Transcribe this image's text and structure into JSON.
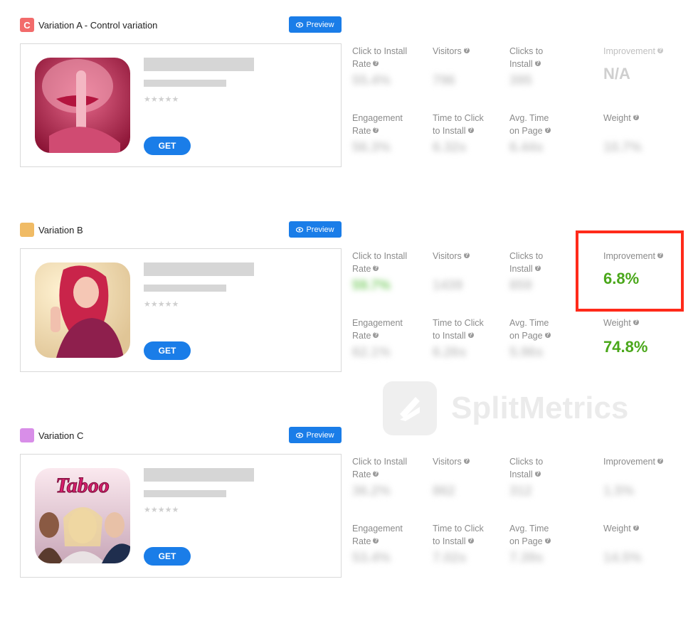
{
  "preview_label": "Preview",
  "get_label": "GET",
  "stars": "★★★★★",
  "watermark_text": "SplitMetrics",
  "labels": {
    "ctir_1": "Click to Install",
    "ctir_2": "Rate",
    "visitors": "Visitors",
    "clicks_1": "Clicks to",
    "clicks_2": "Install",
    "improvement": "Improvement",
    "eng_1": "Engagement",
    "eng_2": "Rate",
    "ttc_1": "Time to Click",
    "ttc_2": "to Install",
    "avg_1": "Avg. Time",
    "avg_2": "on Page",
    "weight": "Weight"
  },
  "variations": [
    {
      "badge": "C",
      "title": "Variation A - Control variation",
      "color": "#f26b6b",
      "values": {
        "ctir": "55.4%",
        "visitors": "796",
        "clicks": "395",
        "improvement": "N/A",
        "engagement": "56.3%",
        "ttc": "6.32s",
        "avg": "6.44s",
        "weight": "10.7%"
      }
    },
    {
      "badge": "",
      "title": "Variation B",
      "color": "#f0bb65",
      "values": {
        "ctir": "59.7%",
        "visitors": "1439",
        "clicks": "859",
        "improvement": "6.8%",
        "engagement": "62.1%",
        "ttc": "6.26s",
        "avg": "5.96s",
        "weight": "74.8%"
      }
    },
    {
      "badge": "",
      "title": "Variation C",
      "color": "#d88ee8",
      "values": {
        "ctir": "36.2%",
        "visitors": "862",
        "clicks": "312",
        "improvement": "1.5%",
        "engagement": "53.4%",
        "ttc": "7.02s",
        "avg": "7.39s",
        "weight": "14.5%"
      }
    }
  ],
  "icons": [
    "eye-icon",
    "question-icon",
    "splitmetrics-logo-icon"
  ]
}
